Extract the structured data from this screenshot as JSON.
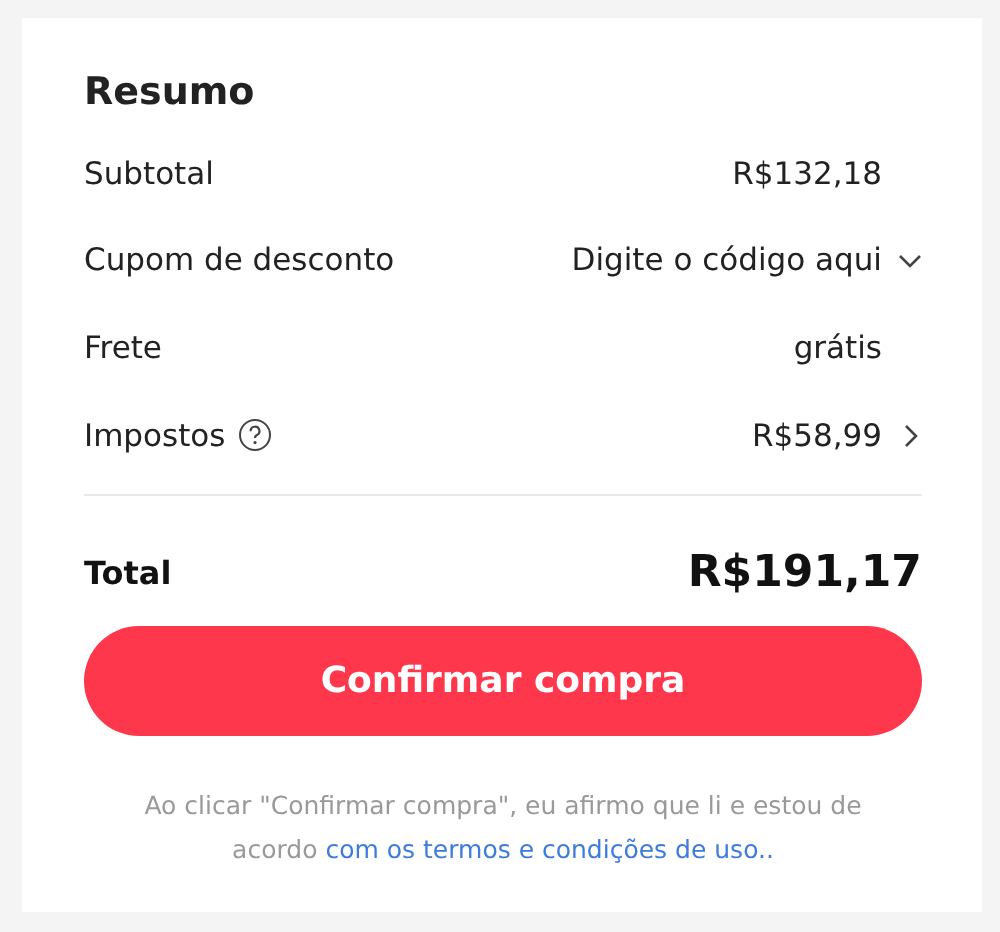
{
  "title": "Resumo",
  "rows": [
    {
      "kind": "plain",
      "label": "Subtotal",
      "value": "R$132,18"
    },
    {
      "kind": "dropdown",
      "label": "Cupom de desconto",
      "value": "Digite o código aqui"
    },
    {
      "kind": "plain",
      "label": "Frete",
      "value": "grátis"
    },
    {
      "kind": "info",
      "label": "Impostos",
      "value": "R$58,99"
    }
  ],
  "total": {
    "label": "Total",
    "value": "R$191,17"
  },
  "button": "Confirmar compra",
  "note": {
    "text": "Ao clicar \"Confirmar compra\", eu afirmo que li e estou de acordo",
    "link": "com os termos e condições de uso.."
  }
}
